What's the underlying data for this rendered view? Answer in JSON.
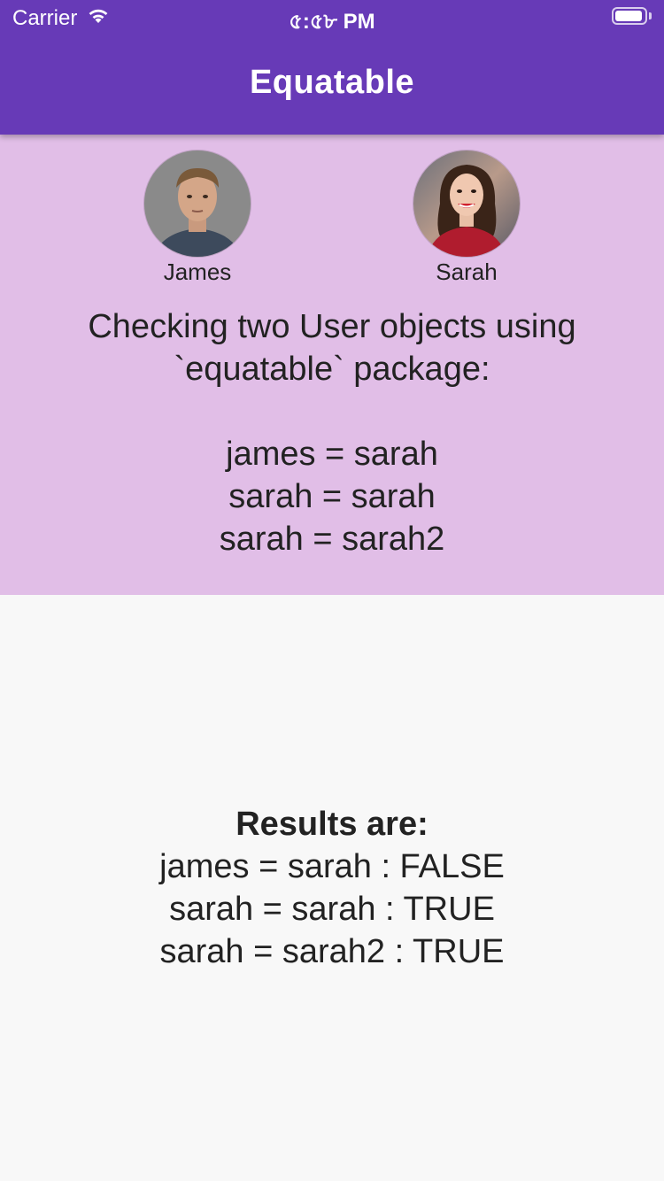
{
  "status_bar": {
    "carrier": "Carrier",
    "time": "৫:৫৮ PM",
    "battery_level": 0.95
  },
  "app_bar": {
    "title": "Equatable"
  },
  "users": [
    {
      "name": "James"
    },
    {
      "name": "Sarah"
    }
  ],
  "description": {
    "line1": "Checking two User objects using",
    "line2": "`equatable` package:",
    "comparisons": [
      "james = sarah",
      "sarah = sarah",
      "sarah = sarah2"
    ]
  },
  "results": {
    "heading": "Results are:",
    "lines": [
      "james = sarah : FALSE",
      "sarah = sarah : TRUE",
      "sarah = sarah2 : TRUE"
    ]
  },
  "colors": {
    "app_bar": "#673ab7",
    "panel": "#e1bee7",
    "background": "#f8f8f8"
  }
}
